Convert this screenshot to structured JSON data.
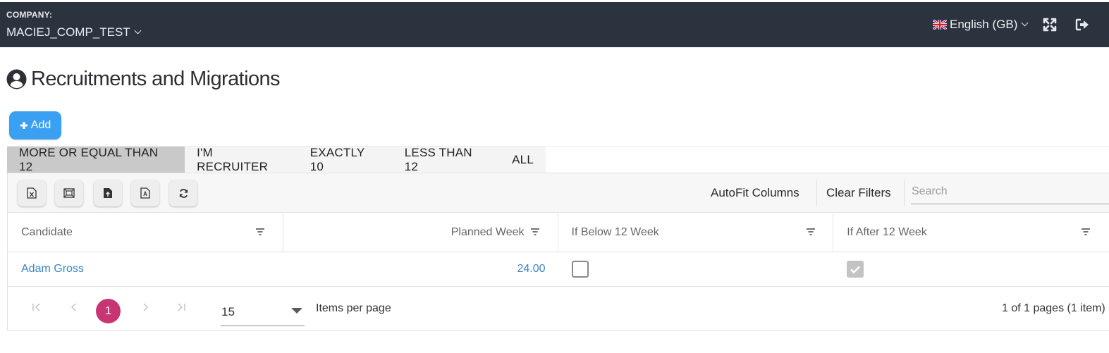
{
  "header": {
    "company_label": "COMPANY:",
    "company_name": "MACIEJ_COMP_TEST",
    "language": "English (GB)",
    "background": "#2b333e"
  },
  "page": {
    "title": "Recruitments and Migrations",
    "title_icon": "user-circle-icon"
  },
  "actions": {
    "add_label": "Add",
    "add_color": "#3b9ff2"
  },
  "tabs": [
    {
      "label": "MORE OR EQUAL THAN 12",
      "active": true
    },
    {
      "label": "I'M RECRUITER",
      "active": false
    },
    {
      "label": "EXACTLY 10",
      "active": false
    },
    {
      "label": "LESS THAN 12",
      "active": false
    },
    {
      "label": "ALL",
      "active": false
    }
  ],
  "toolbar": {
    "icons": [
      "export-excel-icon",
      "export-image-icon",
      "import-file-icon",
      "export-pdf-icon",
      "refresh-icon"
    ],
    "autofit_label": "AutoFit Columns",
    "clear_filters_label": "Clear Filters",
    "search_placeholder": "Search"
  },
  "table": {
    "columns": [
      {
        "label": "Candidate"
      },
      {
        "label": "Planned Week"
      },
      {
        "label": "If Below 12 Week"
      },
      {
        "label": "If After 12 Week"
      }
    ],
    "rows": [
      {
        "candidate": "Adam Gross",
        "planned_week": "24.00",
        "if_below_12_week": false,
        "if_after_12_week": true
      }
    ]
  },
  "pagination": {
    "current_page": "1",
    "page_size": "15",
    "items_per_page_label": "Items per page",
    "info": "1 of 1 pages (1 item)",
    "accent": "#c73573"
  }
}
